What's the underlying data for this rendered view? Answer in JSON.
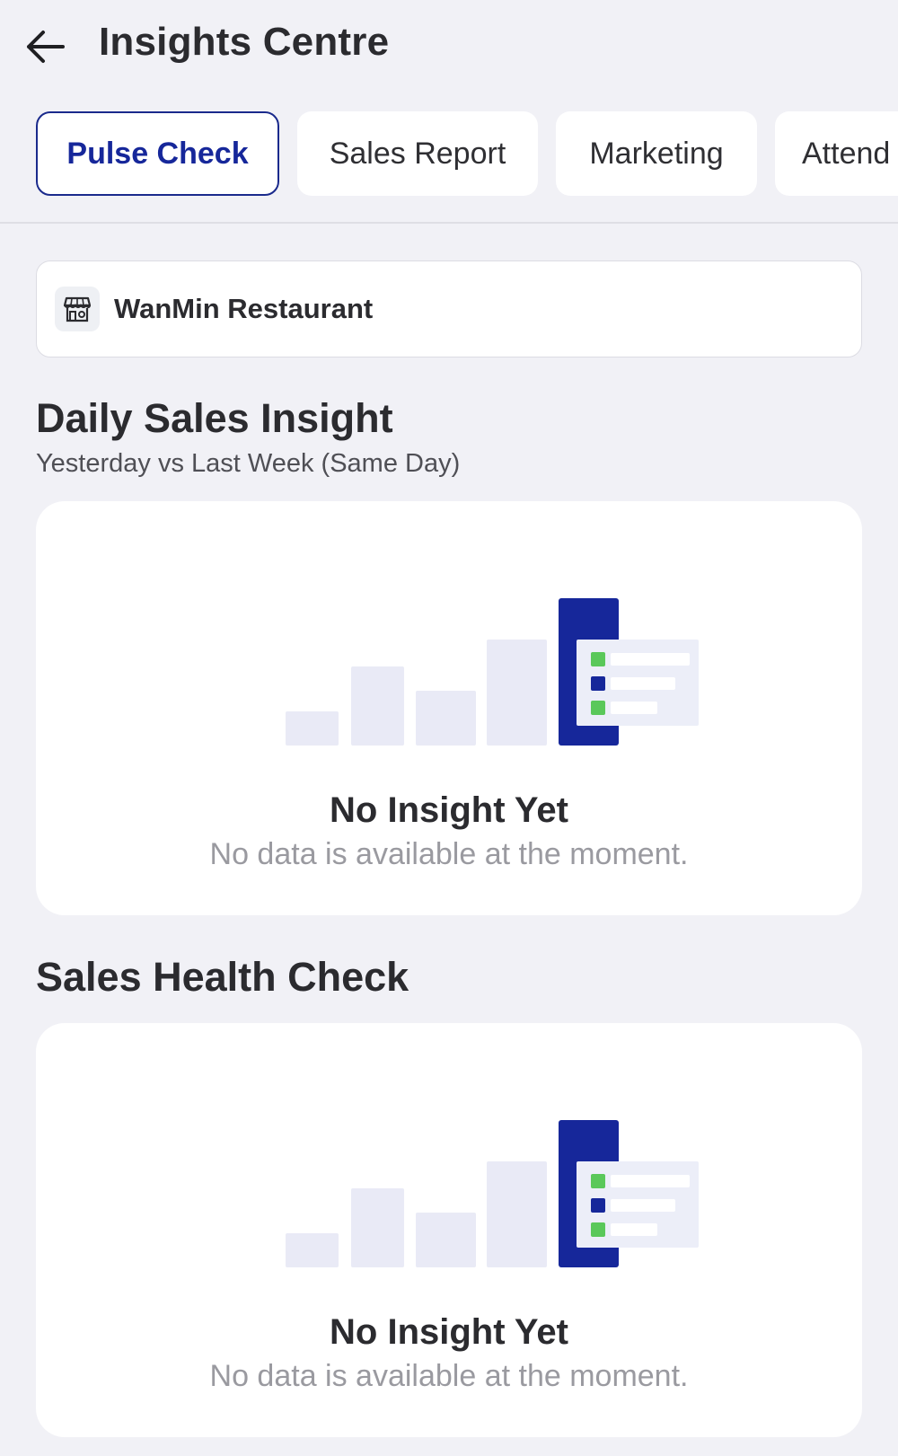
{
  "header": {
    "title": "Insights Centre",
    "back_icon": "arrow-left-icon"
  },
  "tabs": [
    {
      "label": "Pulse Check",
      "active": true
    },
    {
      "label": "Sales Report",
      "active": false
    },
    {
      "label": "Marketing",
      "active": false
    },
    {
      "label": "Attend",
      "active": false
    }
  ],
  "store": {
    "icon": "storefront-icon",
    "name": "WanMin Restaurant"
  },
  "daily_sales_insight": {
    "title": "Daily Sales Insight",
    "subtitle": "Yesterday vs Last Week (Same Day)",
    "empty_title": "No Insight Yet",
    "empty_message": "No data is available at the moment."
  },
  "sales_health_check": {
    "title": "Sales Health Check",
    "empty_title": "No Insight Yet",
    "empty_message": "No data is available at the moment."
  },
  "colors": {
    "background": "#f1f1f6",
    "accent": "#16279a",
    "bar_light": "#e9eaf6",
    "legend_green": "#5ac85a"
  }
}
